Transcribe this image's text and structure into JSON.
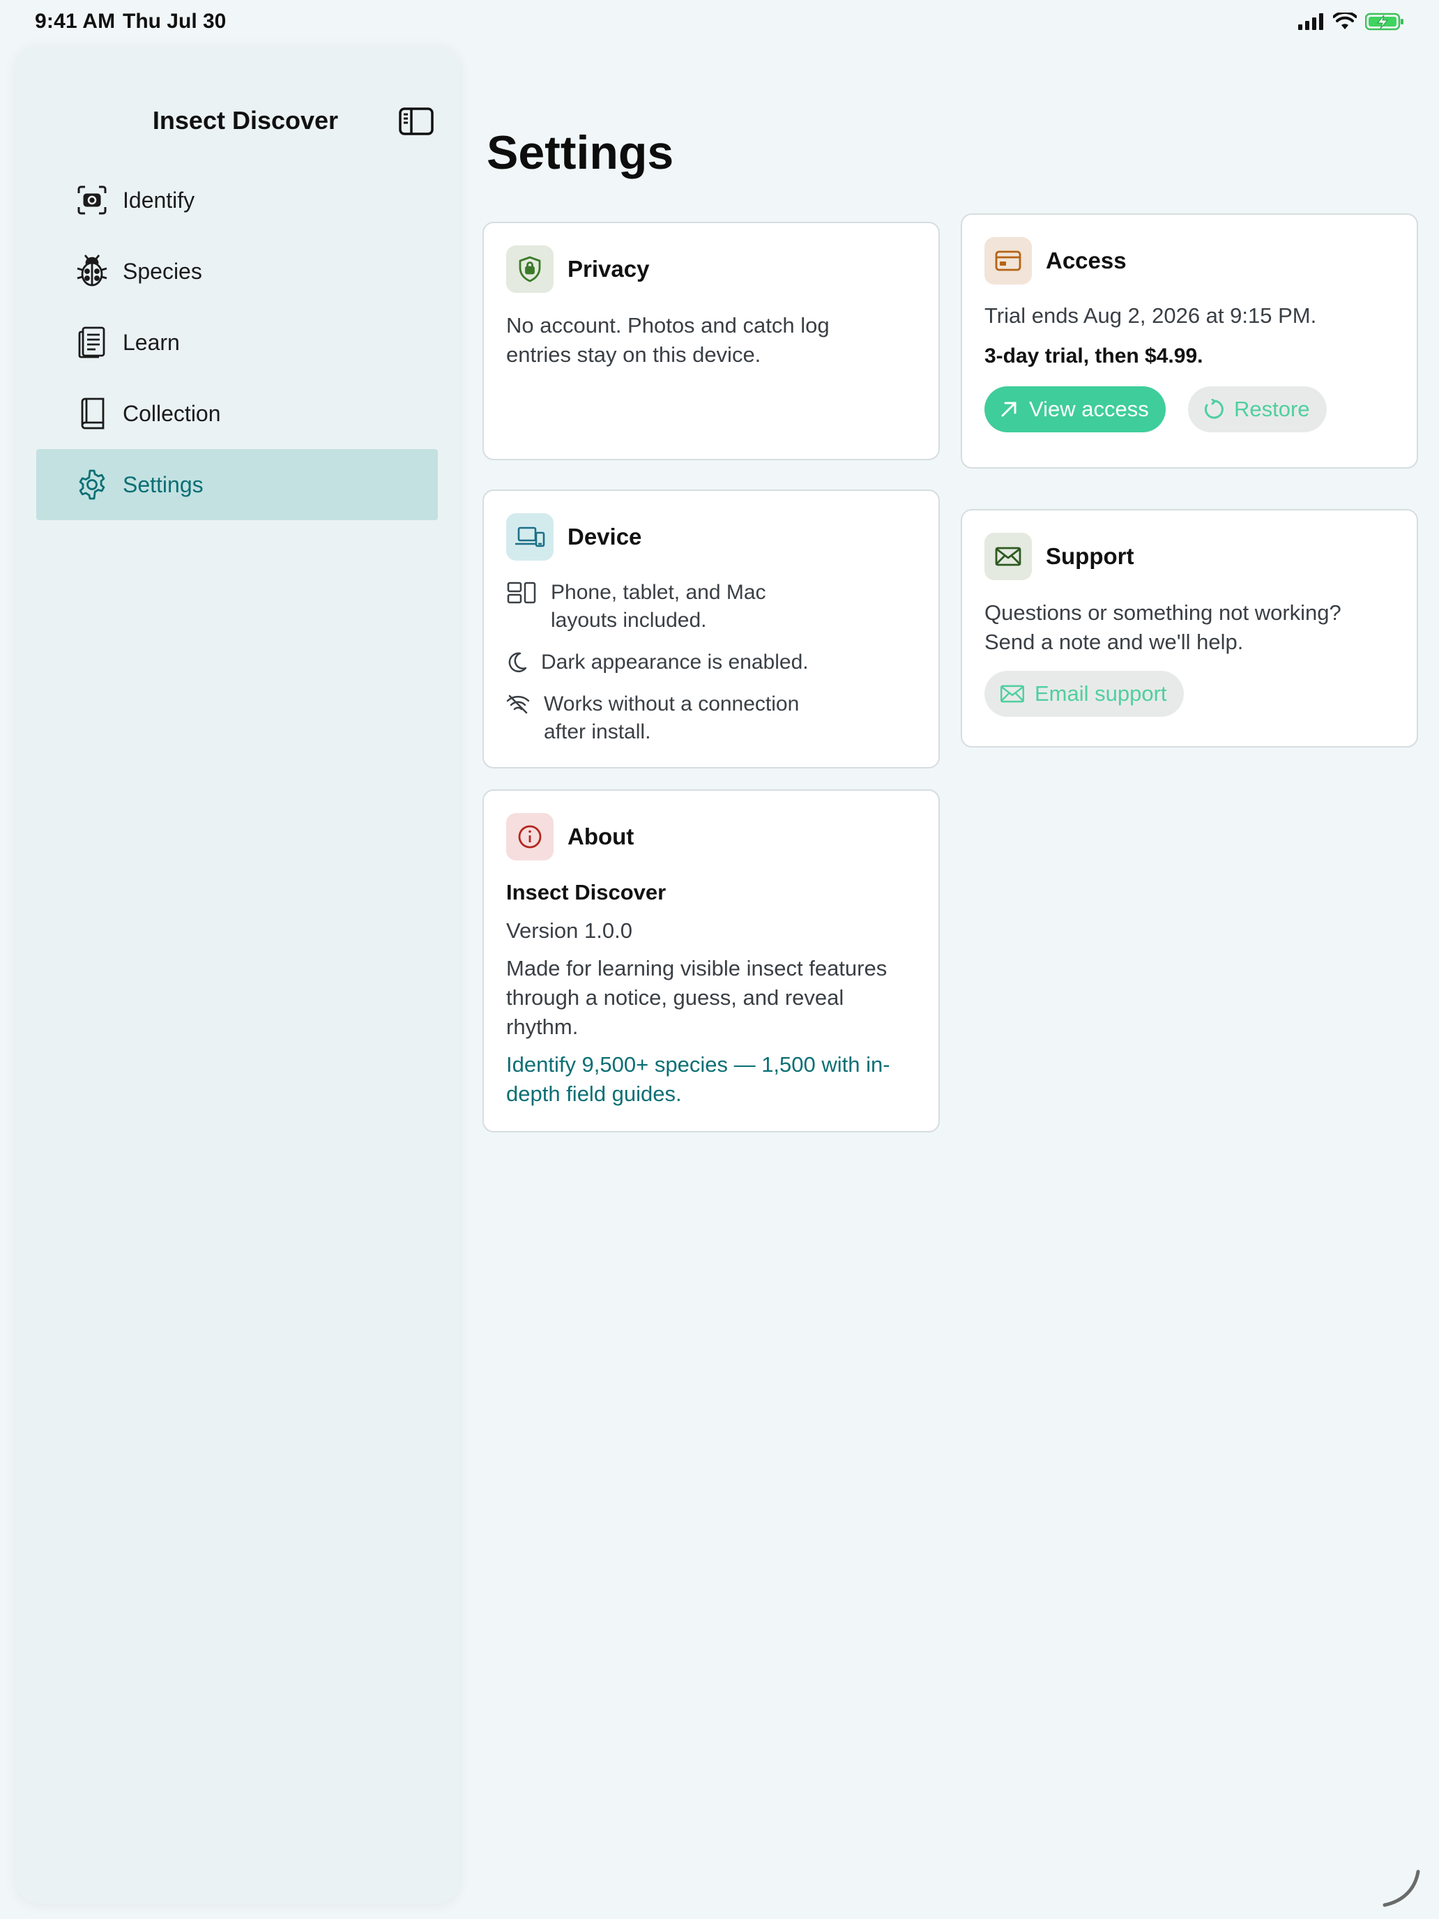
{
  "status_bar": {
    "time": "9:41 AM",
    "date": "Thu Jul 30"
  },
  "sidebar": {
    "title": "Insect Discover",
    "items": [
      {
        "label": "Identify",
        "icon": "camera-viewfinder-icon"
      },
      {
        "label": "Species",
        "icon": "ladybug-icon"
      },
      {
        "label": "Learn",
        "icon": "document-text-icon"
      },
      {
        "label": "Collection",
        "icon": "book-icon"
      },
      {
        "label": "Settings",
        "icon": "gear-icon",
        "active": true
      }
    ]
  },
  "main": {
    "title": "Settings",
    "privacy": {
      "title": "Privacy",
      "text": "No account. Photos and catch log entries stay on this device."
    },
    "access": {
      "title": "Access",
      "trial_text": "Trial ends Aug 2, 2026 at 9:15 PM.",
      "price_text": "3-day trial, then $4.99.",
      "view_button": "View access",
      "restore_button": "Restore"
    },
    "device": {
      "title": "Device",
      "features": [
        "Phone, tablet, and Mac layouts included.",
        "Dark appearance is enabled.",
        "Works without a connection after install."
      ]
    },
    "support": {
      "title": "Support",
      "text": "Questions or something not working? Send a note and we'll help.",
      "email_button": "Email support"
    },
    "about": {
      "title": "About",
      "app_name": "Insect Discover",
      "version": "Version 1.0.0",
      "description": "Made for learning visible insect features through a notice, guess, and reveal rhythm.",
      "tagline": "Identify 9,500+ species — 1,500 with in-depth field guides."
    }
  },
  "colors": {
    "accent": "#0b6f74",
    "primary_button": "#3fcd9b",
    "sidebar_active": "#c3e1e1",
    "background": "#f1f7f8"
  }
}
